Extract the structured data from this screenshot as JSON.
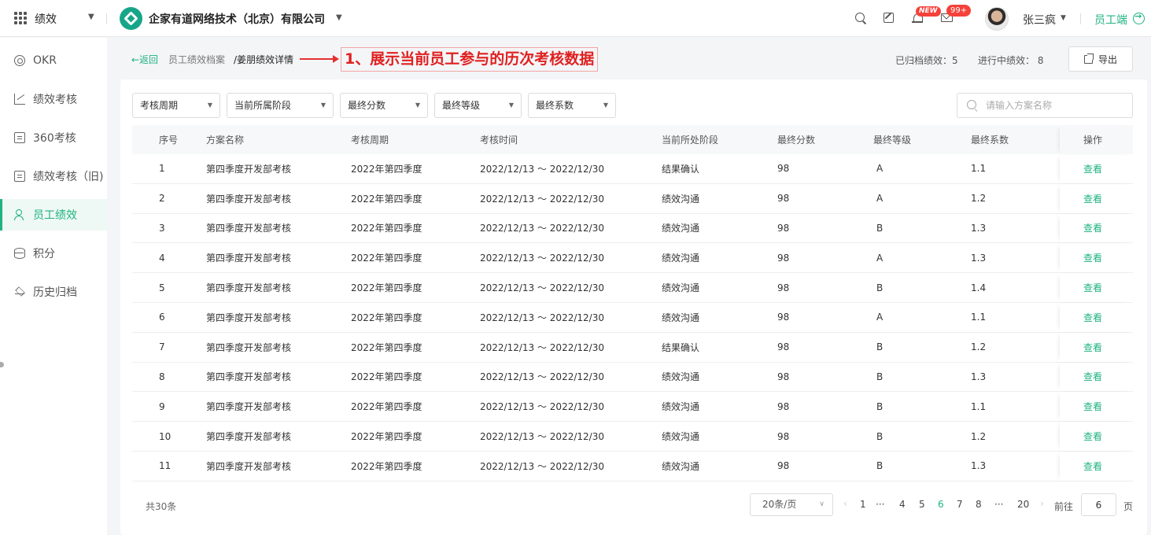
{
  "topbar": {
    "module": "绩效",
    "company": "企家有道网络技术（北京）有限公司",
    "badge_new": "NEW",
    "badge_count": "99+",
    "user_name": "张三疯",
    "employee_link": "员工端",
    "icons": [
      "apps-grid-icon",
      "company-logo",
      "search-icon",
      "edit-icon",
      "bell-icon",
      "mail-icon",
      "avatar",
      "arrow-right-circle-icon"
    ]
  },
  "sidebar": {
    "items": [
      {
        "label": "OKR",
        "icon": "target-icon"
      },
      {
        "label": "绩效考核",
        "icon": "line-chart-icon"
      },
      {
        "label": "360考核",
        "icon": "review-doc-icon"
      },
      {
        "label": "绩效考核（旧)",
        "icon": "edit-doc-icon"
      },
      {
        "label": "员工绩效",
        "icon": "user-icon",
        "active": true
      },
      {
        "label": "积分",
        "icon": "database-icon"
      },
      {
        "label": "历史归档",
        "icon": "layers-icon"
      }
    ]
  },
  "header": {
    "back": "←返回",
    "crumb_parent": "员工绩效档案",
    "crumb_current": "/姜朋绩效详情",
    "annotation": "1、展示当前员工参与的历次考核数据",
    "stat_archived": "已归档绩效：5",
    "stat_in_progress": "进行中绩效：  8",
    "export_label": "导出"
  },
  "filters": {
    "period": "考核周期",
    "stage": "当前所属阶段",
    "score": "最终分数",
    "grade": "最终等级",
    "coefficient": "最终系数",
    "search_placeholder": "请输入方案名称"
  },
  "table": {
    "headers": {
      "idx": "序号",
      "name": "方案名称",
      "period": "考核周期",
      "time": "考核时间",
      "stage": "当前所处阶段",
      "score": "最终分数",
      "grade": "最终等级",
      "coef": "最终系数",
      "op": "操作"
    },
    "rows": [
      {
        "idx": "1",
        "name": "第四季度开发部考核",
        "period": "2022年第四季度",
        "time": "2022/12/13 ～ 2022/12/30",
        "stage": "结果确认",
        "score": "98",
        "grade": "A",
        "coef": "1.1",
        "op": "查看"
      },
      {
        "idx": "2",
        "name": "第四季度开发部考核",
        "period": "2022年第四季度",
        "time": "2022/12/13 ～ 2022/12/30",
        "stage": "绩效沟通",
        "score": "98",
        "grade": "A",
        "coef": "1.2",
        "op": "查看"
      },
      {
        "idx": "3",
        "name": "第四季度开发部考核",
        "period": "2022年第四季度",
        "time": "2022/12/13 ～ 2022/12/30",
        "stage": "绩效沟通",
        "score": "98",
        "grade": "B",
        "coef": "1.3",
        "op": "查看"
      },
      {
        "idx": "4",
        "name": "第四季度开发部考核",
        "period": "2022年第四季度",
        "time": "2022/12/13 ～ 2022/12/30",
        "stage": "绩效沟通",
        "score": "98",
        "grade": "A",
        "coef": "1.3",
        "op": "查看"
      },
      {
        "idx": "5",
        "name": "第四季度开发部考核",
        "period": "2022年第四季度",
        "time": "2022/12/13 ～ 2022/12/30",
        "stage": "绩效沟通",
        "score": "98",
        "grade": "B",
        "coef": "1.4",
        "op": "查看"
      },
      {
        "idx": "6",
        "name": "第四季度开发部考核",
        "period": "2022年第四季度",
        "time": "2022/12/13 ～ 2022/12/30",
        "stage": "绩效沟通",
        "score": "98",
        "grade": "A",
        "coef": "1.1",
        "op": "查看"
      },
      {
        "idx": "7",
        "name": "第四季度开发部考核",
        "period": "2022年第四季度",
        "time": "2022/12/13 ～ 2022/12/30",
        "stage": "结果确认",
        "score": "98",
        "grade": "B",
        "coef": "1.2",
        "op": "查看"
      },
      {
        "idx": "8",
        "name": "第四季度开发部考核",
        "period": "2022年第四季度",
        "time": "2022/12/13 ～ 2022/12/30",
        "stage": "绩效沟通",
        "score": "98",
        "grade": "B",
        "coef": "1.3",
        "op": "查看"
      },
      {
        "idx": "9",
        "name": "第四季度开发部考核",
        "period": "2022年第四季度",
        "time": "2022/12/13 ～ 2022/12/30",
        "stage": "绩效沟通",
        "score": "98",
        "grade": "B",
        "coef": "1.1",
        "op": "查看"
      },
      {
        "idx": "10",
        "name": "第四季度开发部考核",
        "period": "2022年第四季度",
        "time": "2022/12/13 ～ 2022/12/30",
        "stage": "绩效沟通",
        "score": "98",
        "grade": "B",
        "coef": "1.2",
        "op": "查看"
      },
      {
        "idx": "11",
        "name": "第四季度开发部考核",
        "period": "2022年第四季度",
        "time": "2022/12/13 ～ 2022/12/30",
        "stage": "绩效沟通",
        "score": "98",
        "grade": "B",
        "coef": "1.3",
        "op": "查看"
      }
    ]
  },
  "footer": {
    "total": "共30条",
    "page_size": "20条/页",
    "pages": [
      "1",
      "···",
      "4",
      "5",
      "6",
      "7",
      "8",
      "···",
      "20"
    ],
    "current_page": "6",
    "goto_label": "前往",
    "goto_value": "6",
    "page_unit": "页"
  },
  "colors": {
    "accent": "#1fb37f",
    "annotation_red": "#e02020",
    "badge_red": "#f5413a"
  }
}
